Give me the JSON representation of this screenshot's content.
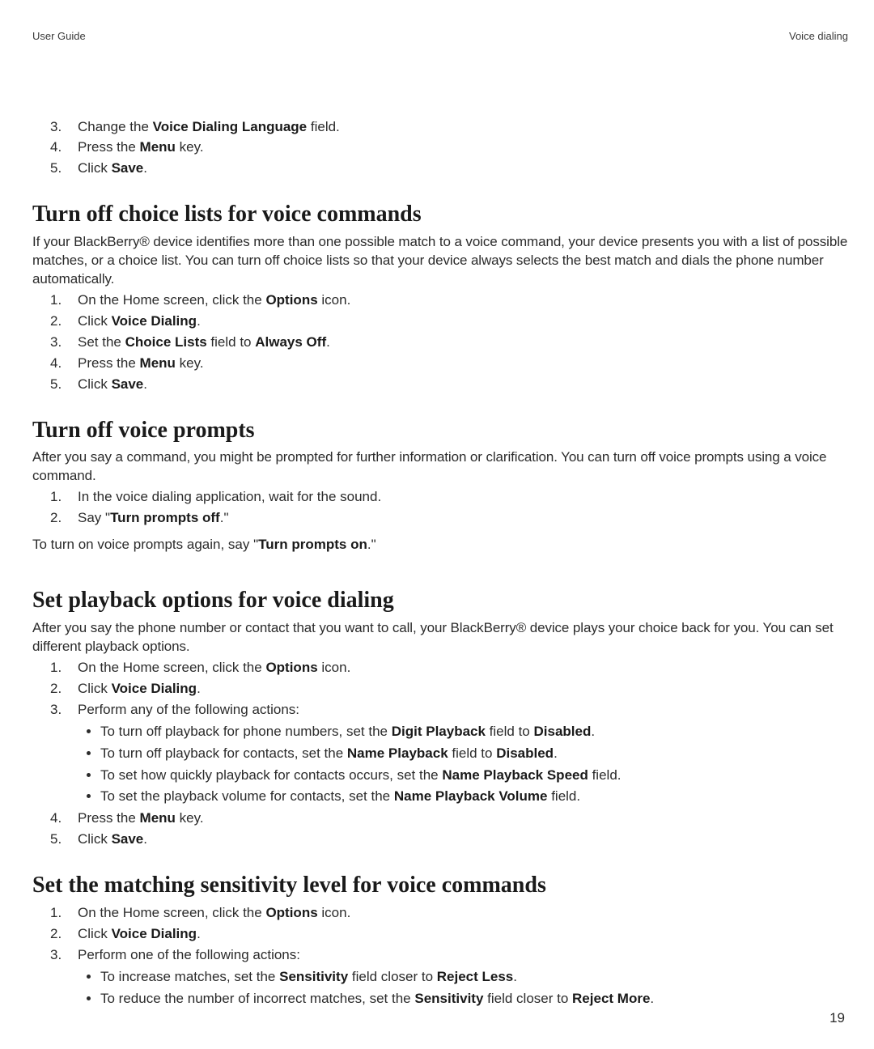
{
  "header": {
    "left": "User Guide",
    "right": "Voice dialing"
  },
  "topSteps": {
    "items": [
      {
        "pre": "Change the ",
        "b1": "Voice Dialing Language",
        "post": " field."
      },
      {
        "pre": "Press the ",
        "b1": "Menu",
        "post": " key."
      },
      {
        "pre": "Click ",
        "b1": "Save",
        "post": "."
      }
    ],
    "start": 3
  },
  "sections": {
    "choiceLists": {
      "title": "Turn off choice lists for voice commands",
      "intro": "If your BlackBerry® device identifies more than one possible match to a voice command, your device presents you with a list of possible matches, or a choice list. You can turn off choice lists so that your device always selects the best match and dials the phone number automatically.",
      "items": [
        {
          "pre": "On the Home screen, click the ",
          "b1": "Options",
          "post": " icon."
        },
        {
          "pre": "Click ",
          "b1": "Voice Dialing",
          "post": "."
        },
        {
          "pre": "Set the ",
          "b1": "Choice Lists",
          "mid": " field to ",
          "b2": "Always Off",
          "post": "."
        },
        {
          "pre": "Press the ",
          "b1": "Menu",
          "post": " key."
        },
        {
          "pre": "Click ",
          "b1": "Save",
          "post": "."
        }
      ]
    },
    "voicePrompts": {
      "title": "Turn off voice prompts",
      "intro": "After you say a command, you might be prompted for further information or clarification. You can turn off voice prompts using a voice command.",
      "items": [
        {
          "pre": "In the voice dialing application, wait for the sound."
        },
        {
          "pre": "Say \"",
          "b1": "Turn prompts off",
          "post": ".\""
        }
      ],
      "afterPre": "To turn on voice prompts again, say \"",
      "afterBold": "Turn prompts on",
      "afterPost": ".\""
    },
    "playback": {
      "title": "Set playback options for voice dialing",
      "intro": "After you say the phone number or contact that you want to call, your BlackBerry® device plays your choice back for you. You can set different playback options.",
      "items": [
        {
          "pre": "On the Home screen, click the ",
          "b1": "Options",
          "post": " icon."
        },
        {
          "pre": "Click ",
          "b1": "Voice Dialing",
          "post": "."
        },
        {
          "pre": "Perform any of the following actions:",
          "sub": [
            {
              "pre": "To turn off playback for phone numbers, set the ",
              "b1": "Digit Playback",
              "mid": " field to ",
              "b2": "Disabled",
              "post": "."
            },
            {
              "pre": "To turn off playback for contacts, set the ",
              "b1": "Name Playback",
              "mid": " field to ",
              "b2": "Disabled",
              "post": "."
            },
            {
              "pre": "To set how quickly playback for contacts occurs, set the ",
              "b1": "Name Playback Speed",
              "post": " field."
            },
            {
              "pre": "To set the playback volume for contacts, set the ",
              "b1": "Name Playback Volume",
              "post": " field."
            }
          ]
        },
        {
          "pre": "Press the ",
          "b1": "Menu",
          "post": " key."
        },
        {
          "pre": "Click ",
          "b1": "Save",
          "post": "."
        }
      ]
    },
    "sensitivity": {
      "title": "Set the matching sensitivity level for voice commands",
      "items": [
        {
          "pre": "On the Home screen, click the ",
          "b1": "Options",
          "post": " icon."
        },
        {
          "pre": "Click ",
          "b1": "Voice Dialing",
          "post": "."
        },
        {
          "pre": "Perform one of the following actions:",
          "sub": [
            {
              "pre": "To increase matches, set the ",
              "b1": "Sensitivity",
              "mid": " field closer to ",
              "b2": "Reject Less",
              "post": "."
            },
            {
              "pre": "To reduce the number of incorrect matches, set the ",
              "b1": "Sensitivity",
              "mid": " field closer to ",
              "b2": "Reject More",
              "post": "."
            }
          ]
        }
      ]
    }
  },
  "pageNumber": "19"
}
